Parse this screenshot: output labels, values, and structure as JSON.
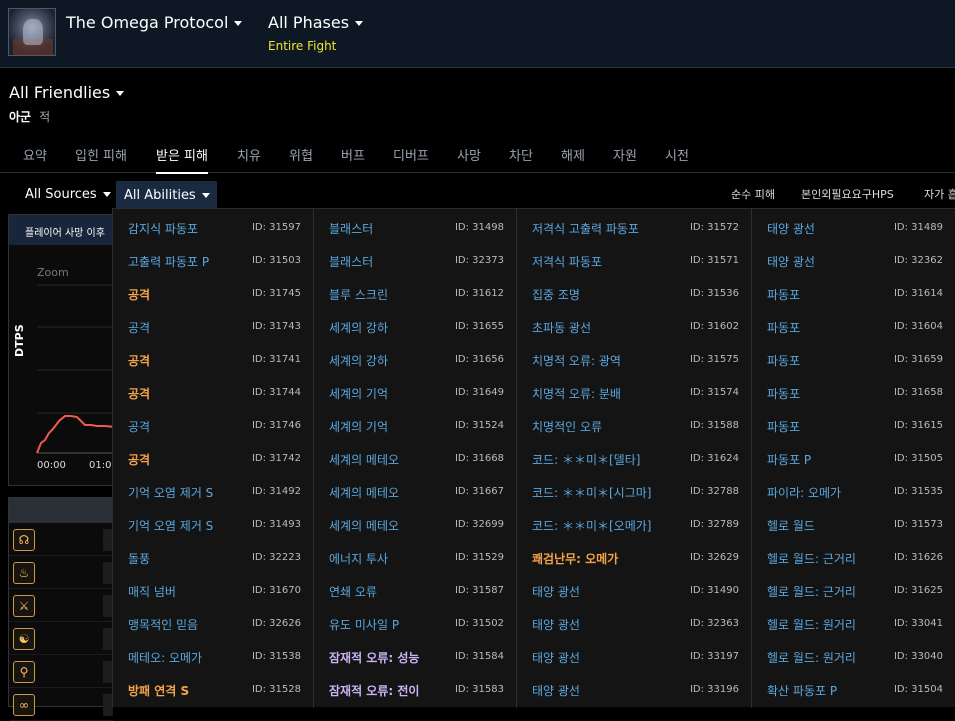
{
  "header": {
    "encounter_title": "The Omega Protocol",
    "phase_title": "All Phases",
    "phase_subtitle": "Entire Fight",
    "friendlies_label": "All Friendlies",
    "filter_allies": "아군",
    "filter_enemies": "적"
  },
  "tabs": [
    {
      "label": "요약"
    },
    {
      "label": "입힌 피해"
    },
    {
      "label": "받은 피해",
      "active": true
    },
    {
      "label": "치유"
    },
    {
      "label": "위협"
    },
    {
      "label": "버프"
    },
    {
      "label": "디버프"
    },
    {
      "label": "사망"
    },
    {
      "label": "차단"
    },
    {
      "label": "해제"
    },
    {
      "label": "자원"
    },
    {
      "label": "시전"
    }
  ],
  "toolbar": {
    "sources_label": "All Sources",
    "abilities_label": "All Abilities",
    "right_links": [
      "순수 피해",
      "본인외필요요구HPS",
      "자가 흡"
    ]
  },
  "chart_panel": {
    "header": "플레이어 사망 이후",
    "zoom_label": "Zoom",
    "ylabel": "DTPS",
    "time_labels": [
      "00:00",
      "01:0"
    ]
  },
  "colors": {
    "blue_ability": "#5ba8e0",
    "orange_ability": "#f5a34a",
    "purple_ability": "#c9b3f5",
    "chart_line": "#f05a50",
    "active_button": "#1a2a40"
  },
  "ability_icons": [
    "omega-sigil-icon",
    "flame-icon",
    "sword-icon",
    "swirl-icon",
    "staff-icon",
    "infinity-icon",
    "shield-icon"
  ],
  "ability_columns": [
    [
      {
        "name": "감지식 파동포",
        "id": "ID: 31597",
        "color": "blue"
      },
      {
        "name": "고출력 파동포 P",
        "id": "ID: 31503",
        "color": "blue"
      },
      {
        "name": "공격",
        "id": "ID: 31745",
        "color": "orange"
      },
      {
        "name": "공격",
        "id": "ID: 31743",
        "color": "blue"
      },
      {
        "name": "공격",
        "id": "ID: 31741",
        "color": "orange"
      },
      {
        "name": "공격",
        "id": "ID: 31744",
        "color": "orange"
      },
      {
        "name": "공격",
        "id": "ID: 31746",
        "color": "blue"
      },
      {
        "name": "공격",
        "id": "ID: 31742",
        "color": "orange"
      },
      {
        "name": "기억 오염 제거 S",
        "id": "ID: 31492",
        "color": "blue"
      },
      {
        "name": "기억 오염 제거 S",
        "id": "ID: 31493",
        "color": "blue"
      },
      {
        "name": "돌풍",
        "id": "ID: 32223",
        "color": "blue"
      },
      {
        "name": "매직 넘버",
        "id": "ID: 31670",
        "color": "blue"
      },
      {
        "name": "맹목적인 믿음",
        "id": "ID: 32626",
        "color": "blue"
      },
      {
        "name": "메테오: 오메가",
        "id": "ID: 31538",
        "color": "blue"
      },
      {
        "name": "방패 연격 S",
        "id": "ID: 31528",
        "color": "orange"
      }
    ],
    [
      {
        "name": "블래스터",
        "id": "ID: 31498",
        "color": "blue"
      },
      {
        "name": "블래스터",
        "id": "ID: 32373",
        "color": "blue"
      },
      {
        "name": "블루 스크린",
        "id": "ID: 31612",
        "color": "blue"
      },
      {
        "name": "세계의 강하",
        "id": "ID: 31655",
        "color": "blue"
      },
      {
        "name": "세계의 강하",
        "id": "ID: 31656",
        "color": "blue"
      },
      {
        "name": "세계의 기억",
        "id": "ID: 31649",
        "color": "blue"
      },
      {
        "name": "세계의 기억",
        "id": "ID: 31524",
        "color": "blue"
      },
      {
        "name": "세계의 메테오",
        "id": "ID: 31668",
        "color": "blue"
      },
      {
        "name": "세계의 메테오",
        "id": "ID: 31667",
        "color": "blue"
      },
      {
        "name": "세계의 메테오",
        "id": "ID: 32699",
        "color": "blue"
      },
      {
        "name": "에너지 투사",
        "id": "ID: 31529",
        "color": "blue"
      },
      {
        "name": "연쇄 오류",
        "id": "ID: 31587",
        "color": "blue"
      },
      {
        "name": "유도 미사일 P",
        "id": "ID: 31502",
        "color": "blue"
      },
      {
        "name": "잠재적 오류: 성능",
        "id": "ID: 31584",
        "color": "purple"
      },
      {
        "name": "잠재적 오류: 전이",
        "id": "ID: 31583",
        "color": "purple"
      }
    ],
    [
      {
        "name": "저격식 고출력 파동포",
        "id": "ID: 31572",
        "color": "blue"
      },
      {
        "name": "저격식 파동포",
        "id": "ID: 31571",
        "color": "blue"
      },
      {
        "name": "집중 조명",
        "id": "ID: 31536",
        "color": "blue"
      },
      {
        "name": "초파동 광선",
        "id": "ID: 31602",
        "color": "blue"
      },
      {
        "name": "치명적 오류: 광역",
        "id": "ID: 31575",
        "color": "blue"
      },
      {
        "name": "치명적 오류: 분배",
        "id": "ID: 31574",
        "color": "blue"
      },
      {
        "name": "치명적인 오류",
        "id": "ID: 31588",
        "color": "blue"
      },
      {
        "name": "코드: ＊＊미＊[델타]",
        "id": "ID: 31624",
        "color": "blue"
      },
      {
        "name": "코드: ＊＊미＊[시그마]",
        "id": "ID: 32788",
        "color": "blue"
      },
      {
        "name": "코드: ＊＊미＊[오메가]",
        "id": "ID: 32789",
        "color": "blue"
      },
      {
        "name": "쾌검난무: 오메가",
        "id": "ID: 32629",
        "color": "orange"
      },
      {
        "name": "태양 광선",
        "id": "ID: 31490",
        "color": "blue"
      },
      {
        "name": "태양 광선",
        "id": "ID: 32363",
        "color": "blue"
      },
      {
        "name": "태양 광선",
        "id": "ID: 33197",
        "color": "blue"
      },
      {
        "name": "태양 광선",
        "id": "ID: 33196",
        "color": "blue"
      }
    ],
    [
      {
        "name": "태양 광선",
        "id": "ID: 31489",
        "color": "blue"
      },
      {
        "name": "태양 광선",
        "id": "ID: 32362",
        "color": "blue"
      },
      {
        "name": "파동포",
        "id": "ID: 31614",
        "color": "blue"
      },
      {
        "name": "파동포",
        "id": "ID: 31604",
        "color": "blue"
      },
      {
        "name": "파동포",
        "id": "ID: 31659",
        "color": "blue"
      },
      {
        "name": "파동포",
        "id": "ID: 31658",
        "color": "blue"
      },
      {
        "name": "파동포",
        "id": "ID: 31615",
        "color": "blue"
      },
      {
        "name": "파동포 P",
        "id": "ID: 31505",
        "color": "blue"
      },
      {
        "name": "파이라: 오메가",
        "id": "ID: 31535",
        "color": "blue"
      },
      {
        "name": "헬로 월드",
        "id": "ID: 31573",
        "color": "blue"
      },
      {
        "name": "헬로 월드: 근거리",
        "id": "ID: 31626",
        "color": "blue"
      },
      {
        "name": "헬로 월드: 근거리",
        "id": "ID: 31625",
        "color": "blue"
      },
      {
        "name": "헬로 월드: 원거리",
        "id": "ID: 33041",
        "color": "blue"
      },
      {
        "name": "헬로 월드: 원거리",
        "id": "ID: 33040",
        "color": "blue"
      },
      {
        "name": "확산 파동포 P",
        "id": "ID: 31504",
        "color": "blue"
      }
    ]
  ]
}
